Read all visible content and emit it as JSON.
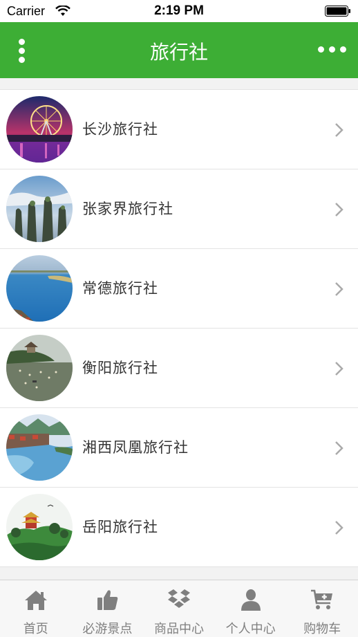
{
  "status_bar": {
    "carrier": "Carrier",
    "time": "2:19 PM"
  },
  "nav": {
    "title": "旅行社"
  },
  "agencies": [
    {
      "name": "长沙旅行社"
    },
    {
      "name": "张家界旅行社"
    },
    {
      "name": "常德旅行社"
    },
    {
      "name": "衡阳旅行社"
    },
    {
      "name": "湘西凤凰旅行社"
    },
    {
      "name": "岳阳旅行社"
    }
  ],
  "tabs": [
    {
      "label": "首页",
      "icon": "home-icon"
    },
    {
      "label": "必游景点",
      "icon": "thumbs-up-icon"
    },
    {
      "label": "商品中心",
      "icon": "dropbox-icon"
    },
    {
      "label": "个人中心",
      "icon": "user-icon"
    },
    {
      "label": "购物车",
      "icon": "cart-plus-icon"
    }
  ],
  "colors": {
    "accent": "#3dae35",
    "tab_icon": "#7f7f7f",
    "row_text": "#333333"
  }
}
